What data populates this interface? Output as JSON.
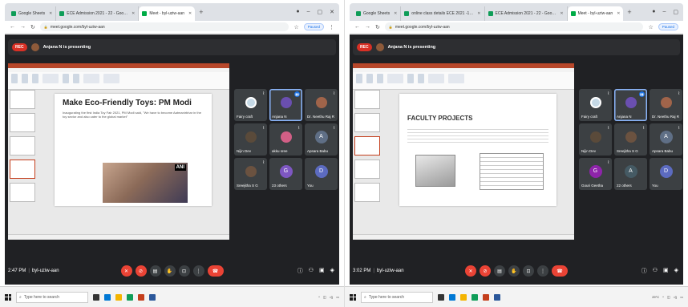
{
  "left": {
    "tabs": [
      {
        "label": "Google Sheets",
        "color": "#0f9d58",
        "active": false
      },
      {
        "label": "ECE Admission 2021 - 22 - Goo…",
        "color": "#0f9d58",
        "active": false
      },
      {
        "label": "Meet - byl-uziw-aan",
        "color": "#00ac47",
        "active": true
      }
    ],
    "url": "meet.google.com/byl-uziw-aan",
    "paused": "Paused",
    "rec": "REC",
    "presenting": "Anjana N is presenting",
    "slide": {
      "title": "Make Eco-Friendly Toys: PM Modi",
      "body": "Inaugurating the first India Toy Fair 2021, PM Modi said, \"We have to become Aatmanirbhar in the toy sector and also cater to the global market\"",
      "badge": "ANI"
    },
    "tiles": [
      {
        "name": "Fairy craft",
        "kind": "icon",
        "color": "#c5d9e6",
        "speaking": false,
        "mic": "muted"
      },
      {
        "name": "Anjana N",
        "kind": "photo",
        "color": "#6a4fb0",
        "speaking": true,
        "mic": "active"
      },
      {
        "name": "Dr. Neethu Raj R",
        "kind": "photo",
        "color": "#a0644a",
        "speaking": false,
        "mic": "muted"
      },
      {
        "name": "Nijin Dev",
        "kind": "photo",
        "color": "#5a4a3a",
        "speaking": false,
        "mic": "muted"
      },
      {
        "name": "akku sree",
        "kind": "photo",
        "color": "#d25f86",
        "speaking": false,
        "mic": "muted"
      },
      {
        "name": "Apsara Babu",
        "kind": "letter",
        "letter": "A",
        "color": "#5f6f86",
        "speaking": false,
        "mic": "muted"
      },
      {
        "name": "Sreejitha S G",
        "kind": "photo",
        "color": "#6b5240",
        "speaking": false,
        "mic": "muted"
      },
      {
        "name": "23 others",
        "kind": "letter",
        "letter": "G",
        "color": "#7e57c2",
        "speaking": false,
        "mic": "none"
      },
      {
        "name": "You",
        "kind": "letter",
        "letter": "D",
        "color": "#5c6bc0",
        "speaking": false,
        "mic": "none"
      }
    ],
    "time": "2:47 PM",
    "code": "byl-uziw-aan",
    "search": "Type here to search"
  },
  "right": {
    "tabs": [
      {
        "label": "Google Sheets",
        "color": "#0f9d58",
        "active": false
      },
      {
        "label": "online class details ECE 2021 -1…",
        "color": "#0f9d58",
        "active": false
      },
      {
        "label": "ECE Admission 2021 - 22 - Goo…",
        "color": "#0f9d58",
        "active": false
      },
      {
        "label": "Meet - byl-uziw-aan",
        "color": "#00ac47",
        "active": true
      }
    ],
    "url": "meet.google.com/byl-uziw-aan",
    "paused": "Paused",
    "rec": "REC",
    "presenting": "Anjana N is presenting",
    "slide": {
      "title": "FACULTY PROJECTS"
    },
    "tiles": [
      {
        "name": "Fairy craft",
        "kind": "icon",
        "color": "#c5d9e6",
        "speaking": false,
        "mic": "muted"
      },
      {
        "name": "Anjana N",
        "kind": "photo",
        "color": "#6a4fb0",
        "speaking": true,
        "mic": "active"
      },
      {
        "name": "Dr. Neethu Raj R",
        "kind": "photo",
        "color": "#a0644a",
        "speaking": false,
        "mic": "muted"
      },
      {
        "name": "Nijin Dev",
        "kind": "photo",
        "color": "#5a4a3a",
        "speaking": false,
        "mic": "muted"
      },
      {
        "name": "Sreejitha S G",
        "kind": "photo",
        "color": "#6b5240",
        "speaking": false,
        "mic": "muted"
      },
      {
        "name": "Apsara Babu",
        "kind": "letter",
        "letter": "A",
        "color": "#5f6f86",
        "speaking": false,
        "mic": "muted"
      },
      {
        "name": "Gouri Geetha",
        "kind": "letter",
        "letter": "G",
        "color": "#8e24aa",
        "speaking": false,
        "mic": "muted"
      },
      {
        "name": "22 others",
        "kind": "letter",
        "letter": "A",
        "color": "#455a64",
        "speaking": false,
        "mic": "none"
      },
      {
        "name": "You",
        "kind": "letter",
        "letter": "D",
        "color": "#5c6bc0",
        "speaking": false,
        "mic": "none"
      }
    ],
    "time": "3:02 PM",
    "code": "byl-uziw-aan",
    "search": "Type here to search",
    "tray_temp": "29°C"
  },
  "icons": {
    "back": "←",
    "forward": "→",
    "reload": "↻",
    "lock": "🔒",
    "mic_off": "✕",
    "cam_off": "⊘",
    "captions": "▤",
    "hand": "✋",
    "present": "⊡",
    "more": "⋮",
    "hangup": "☎",
    "info": "ⓘ",
    "people": "👥",
    "chat": "💬",
    "activities": "◈",
    "search": "⌕"
  },
  "colors": {
    "meet_bg": "#202124",
    "tile_bg": "#3c4043",
    "red": "#ea4335",
    "rec": "#d93025",
    "ppt": "#b7472a"
  }
}
